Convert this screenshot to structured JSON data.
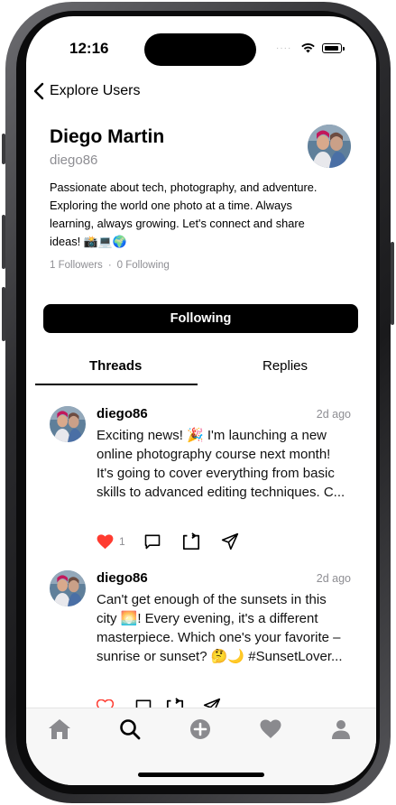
{
  "status": {
    "time": "12:16"
  },
  "nav": {
    "back_label": "Explore Users"
  },
  "profile": {
    "name": "Diego Martin",
    "handle": "diego86",
    "bio": "Passionate about tech, photography, and adventure. Exploring the world one photo at a time. Always learning, always growing. Let's connect and share ideas! 📸💻🌍",
    "followers": "1 Followers",
    "following": "0 Following",
    "follow_button": "Following"
  },
  "tabs": {
    "threads": "Threads",
    "replies": "Replies"
  },
  "posts": [
    {
      "user": "diego86",
      "time": "2d ago",
      "text_lines": [
        "Exciting news! 🎉 I'm launching a new",
        "online photography course next month!",
        "It's going to cover everything from basic",
        "skills to advanced editing techniques. C..."
      ],
      "liked": true,
      "likes": "1"
    },
    {
      "user": "diego86",
      "time": "2d ago",
      "text_lines": [
        "Can't get enough of the sunsets in this",
        "city 🌅! Every evening, it's a different",
        "masterpiece. Which one's your favorite –",
        "sunrise or sunset? 🤔🌙 #SunsetLover..."
      ],
      "liked": false,
      "likes": ""
    }
  ],
  "tabbar": {
    "items": [
      "home-icon",
      "search-icon",
      "compose-icon",
      "heart-icon",
      "profile-icon"
    ],
    "active": "search-icon"
  },
  "colors": {
    "like_red": "#ff3b30",
    "secondary_text": "#8e8e93",
    "tab_icon_gray": "#8a8a8e"
  }
}
